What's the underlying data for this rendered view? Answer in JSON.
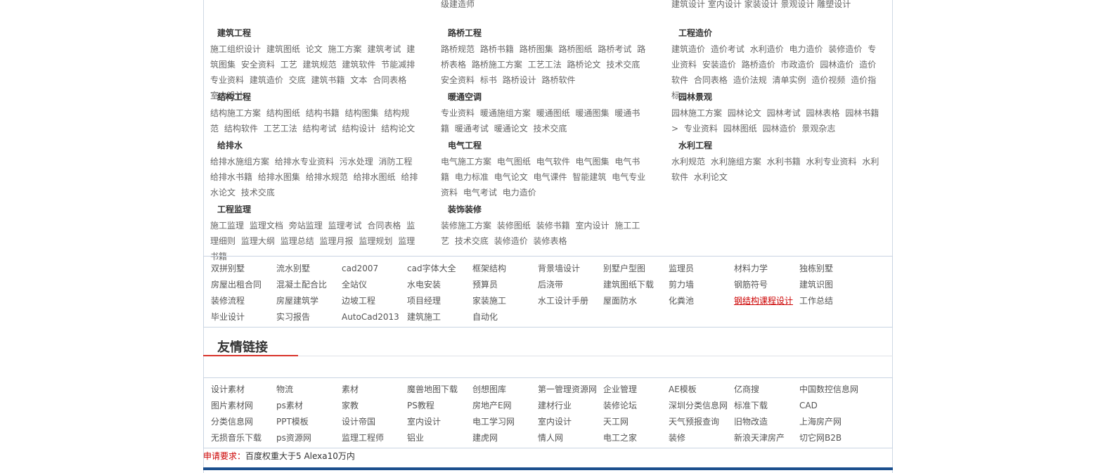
{
  "top_row": {
    "col2": "级建造师",
    "col3": "建筑设计 室内设计 家装设计 景观设计 雕塑设计"
  },
  "categories": [
    {
      "title": "建筑工程",
      "links": [
        "施工组织设计",
        "建筑图纸",
        "论文",
        "施工方案",
        "建筑考试",
        "建筑图集",
        "安全资料",
        "工艺",
        "建筑规范",
        "建筑软件",
        "节能减排",
        "专业资料",
        "建筑造价",
        "交底",
        "建筑书籍",
        "文本",
        "合同表格",
        "室内设计"
      ]
    },
    {
      "title": "路桥工程",
      "links": [
        "路桥规范",
        "路桥书籍",
        "路桥图集",
        "路桥图纸",
        "路桥考试",
        "路桥表格",
        "路桥施工方案",
        "工艺工法",
        "路桥论文",
        "技术交底",
        "安全资料",
        "标书",
        "路桥设计",
        "路桥软件"
      ]
    },
    {
      "title": "工程造价",
      "links": [
        "建筑造价",
        "造价考试",
        "水利造价",
        "电力造价",
        "装修造价",
        "专业资料",
        "安装造价",
        "路桥造价",
        "市政造价",
        "园林造价",
        "造价软件",
        "合同表格",
        "造价法规",
        "清单实例",
        "造价视频",
        "造价指标"
      ]
    },
    {
      "title": "结构工程",
      "links": [
        "结构施工方案",
        "结构图纸",
        "结构书籍",
        "结构图集",
        "结构规范",
        "结构软件",
        "工艺工法",
        "结构考试",
        "结构设计",
        "结构论文"
      ]
    },
    {
      "title": "暖通空调",
      "links": [
        "专业资料",
        "暖通施组方案",
        "暖通图纸",
        "暖通图集",
        "暖通书籍",
        "暖通考试",
        "暖通论文",
        "技术交底"
      ]
    },
    {
      "title": "园林景观",
      "links": [
        "园林施工方案",
        "园林论文",
        "园林考试",
        "园林表格",
        "园林书籍 >",
        "专业资料",
        "园林图纸",
        "园林造价",
        "景观杂志"
      ]
    },
    {
      "title": "给排水",
      "links": [
        "给排水施组方案",
        "给排水专业资料",
        "污水处理",
        "消防工程",
        "给排水书籍",
        "给排水图集",
        "给排水规范",
        "给排水图纸",
        "给排水论文",
        "技术交底"
      ]
    },
    {
      "title": "电气工程",
      "links": [
        "电气施工方案",
        "电气图纸",
        "电气软件",
        "电气图集",
        "电气书籍",
        "电力标准",
        "电气论文",
        "电气课件",
        "智能建筑",
        "电气专业资料",
        "电气考试",
        "电力造价"
      ]
    },
    {
      "title": "水利工程",
      "links": [
        "水利规范",
        "水利施组方案",
        "水利书籍",
        "水利专业资料",
        "水利软件",
        "水利论文"
      ]
    },
    {
      "title": "工程监理",
      "links": [
        "施工监理",
        "监理文档",
        "旁站监理",
        "监理考试",
        "合同表格",
        "监理细则",
        "监理大纲",
        "监理总结",
        "监理月报",
        "监理规划",
        "监理书籍"
      ]
    },
    {
      "title": "装饰装修",
      "links": [
        "装修施工方案",
        "装修图纸",
        "装修书籍",
        "室内设计",
        "施工工艺",
        "技术交底",
        "装修造价",
        "装修表格"
      ]
    }
  ],
  "tags": [
    [
      "双拼别墅",
      "流水别墅",
      "cad2007",
      "cad字体大全",
      "框架结构",
      "背景墙设计",
      "别墅户型图",
      "监理员",
      "材料力学",
      "独栋别墅"
    ],
    [
      "房屋出租合同",
      "混凝土配合比",
      "全站仪",
      "水电安装",
      "预算员",
      "后浇带",
      "建筑图纸下载",
      "剪力墙",
      "钢筋符号",
      "建筑识图"
    ],
    [
      "装修流程",
      "房屋建筑学",
      "边坡工程",
      "项目经理",
      "家装施工",
      "水工设计手册",
      "屋面防水",
      "化粪池",
      "钢结构课程设计",
      "工作总结"
    ],
    [
      "毕业设计",
      "实习报告",
      "AutoCad2013",
      "建筑施工",
      "自动化"
    ]
  ],
  "highlighted_tag": "钢结构课程设计",
  "friend_links_title": "友情链接",
  "friend_links": [
    [
      "设计素材",
      "物流",
      "素材",
      "魔兽地图下载",
      "创想图库",
      "第一管理资源网",
      "企业管理",
      "AE模板",
      "亿商搜",
      "中国数控信息网"
    ],
    [
      "图片素材网",
      "ps素材",
      "家教",
      "PS教程",
      "房地产E网",
      "建材行业",
      "装修论坛",
      "深圳分类信息网",
      "标准下载",
      "CAD"
    ],
    [
      "分类信息网",
      "PPT模板",
      "设计帝国",
      "室内设计",
      "电工学习网",
      "室内设计",
      "天工网",
      "天气预报查询",
      "旧物改造",
      "上海房产网"
    ],
    [
      "无损音乐下载",
      "ps资源网",
      "监理工程师",
      "铝业",
      "建虎网",
      "情人网",
      "电工之家",
      "装修",
      "新浪天津房产",
      "切它网B2B"
    ]
  ],
  "requirement": {
    "label": "申请要求：",
    "text": "百度权重大于5 Alexa10万内"
  },
  "colors": {
    "accent_red": "#d9332b",
    "link_red": "#cc0000",
    "border": "#c9d4e2",
    "bottom_bar": "#1b4f8e"
  }
}
